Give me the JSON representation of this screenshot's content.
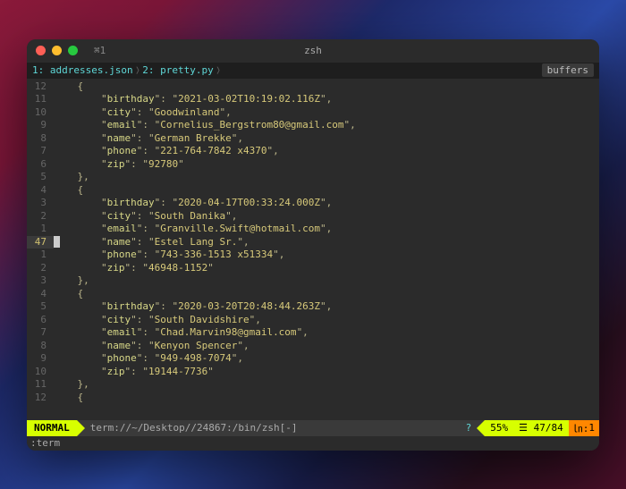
{
  "titlebar": {
    "tab_label": "⌘1",
    "title": "zsh"
  },
  "bufferline": {
    "items": [
      {
        "index": "1:",
        "name": "addresses.json"
      },
      {
        "index": "2:",
        "name": "pretty.py"
      }
    ],
    "buffers_label": "buffers"
  },
  "editor": {
    "current_abs": "47",
    "lines": [
      {
        "rel": "12",
        "indent": "    ",
        "content": "{"
      },
      {
        "rel": "11",
        "indent": "        ",
        "key": "birthday",
        "val": "2021-03-02T10:19:02.116Z",
        "comma": true
      },
      {
        "rel": "10",
        "indent": "        ",
        "key": "city",
        "val": "Goodwinland",
        "comma": true
      },
      {
        "rel": "9",
        "indent": "        ",
        "key": "email",
        "val": "Cornelius_Bergstrom80@gmail.com",
        "comma": true
      },
      {
        "rel": "8",
        "indent": "        ",
        "key": "name",
        "val": "German Brekke",
        "comma": true
      },
      {
        "rel": "7",
        "indent": "        ",
        "key": "phone",
        "val": "221-764-7842 x4370",
        "comma": true
      },
      {
        "rel": "6",
        "indent": "        ",
        "key": "zip",
        "val": "92780"
      },
      {
        "rel": "5",
        "indent": "    ",
        "content": "},"
      },
      {
        "rel": "4",
        "indent": "    ",
        "content": "{"
      },
      {
        "rel": "3",
        "indent": "        ",
        "key": "birthday",
        "val": "2020-04-17T00:33:24.000Z",
        "comma": true
      },
      {
        "rel": "2",
        "indent": "        ",
        "key": "city",
        "val": "South Danika",
        "comma": true
      },
      {
        "rel": "1",
        "indent": "        ",
        "key": "email",
        "val": "Granville.Swift@hotmail.com",
        "comma": true
      },
      {
        "rel": "47",
        "current": true,
        "indent": "        ",
        "key": "name",
        "val": "Estel Lang Sr.",
        "comma": true
      },
      {
        "rel": "1",
        "indent": "        ",
        "key": "phone",
        "val": "743-336-1513 x51334",
        "comma": true
      },
      {
        "rel": "2",
        "indent": "        ",
        "key": "zip",
        "val": "46948-1152"
      },
      {
        "rel": "3",
        "indent": "    ",
        "content": "},"
      },
      {
        "rel": "4",
        "indent": "    ",
        "content": "{"
      },
      {
        "rel": "5",
        "indent": "        ",
        "key": "birthday",
        "val": "2020-03-20T20:48:44.263Z",
        "comma": true
      },
      {
        "rel": "6",
        "indent": "        ",
        "key": "city",
        "val": "South Davidshire",
        "comma": true
      },
      {
        "rel": "7",
        "indent": "        ",
        "key": "email",
        "val": "Chad.Marvin98@gmail.com",
        "comma": true
      },
      {
        "rel": "8",
        "indent": "        ",
        "key": "name",
        "val": "Kenyon Spencer",
        "comma": true
      },
      {
        "rel": "9",
        "indent": "        ",
        "key": "phone",
        "val": "949-498-7074",
        "comma": true
      },
      {
        "rel": "10",
        "indent": "        ",
        "key": "zip",
        "val": "19144-7736"
      },
      {
        "rel": "11",
        "indent": "    ",
        "content": "},"
      },
      {
        "rel": "12",
        "indent": "    ",
        "content": "{"
      }
    ]
  },
  "statusline": {
    "mode": "NORMAL",
    "path": "term://~/Desktop//24867:/bin/zsh[-]",
    "help_icon": "?",
    "percent": "55%",
    "line_info": "☰ 47/84",
    "col_prefix": "㏑:",
    "col": "1"
  },
  "cmdline": ":term"
}
